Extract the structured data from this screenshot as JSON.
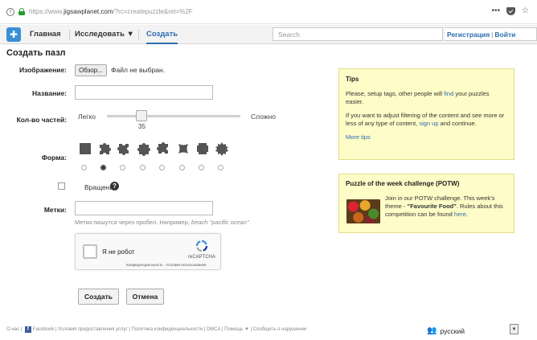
{
  "browser": {
    "url_prefix": "https://www.",
    "url_domain": "jigsawplanet.com",
    "url_rest": "/?rc=createpuzzle&ret=%2F",
    "menu_glyph": "•••",
    "star_glyph": "☆"
  },
  "nav": {
    "logo_glyph": "✚",
    "items": [
      {
        "label": "Главная"
      },
      {
        "label": "Исследовать ▼"
      },
      {
        "label": "Создать"
      }
    ],
    "search_placeholder": "Search",
    "register": "Регистрация",
    "separator": "|",
    "login": "Войти"
  },
  "form": {
    "title": "Создать пазл",
    "image_label": "Изображение:",
    "browse_button": "Обзор...",
    "file_status": "Файл не выбран.",
    "name_label": "Название:",
    "name_value": "",
    "pieces_label": "Кол-во частей:",
    "difficulty_easy": "Легко",
    "difficulty_hard": "Сложно",
    "pieces_value": 35,
    "pieces_value_text": "35",
    "pieces_slider_fraction": 0.2,
    "shape_label": "Форма:",
    "shape_selected_index": 1,
    "rotation_label": "Вращение",
    "rotation_checked": false,
    "help_glyph": "?",
    "tags_label": "Метки:",
    "tags_value": "",
    "tags_hint": "Метки пишутся через пробел. Например, ",
    "tags_hint_example": "beach \"pacific ocean\"",
    "captcha_label": "Я не робот",
    "captcha_brand": "reCAPTCHA",
    "captcha_links": "Конфиденциальность - Условия использования",
    "create_button": "Создать",
    "cancel_button": "Отмена"
  },
  "tips": {
    "title": "Tips",
    "p1_before": "Please, setup tags, other people will ",
    "p1_link": "find",
    "p1_after": " your puzzles easier.",
    "p2_before": "If you want to adjust filtering of the content and see more or less of any type of content, ",
    "p2_link": "sign up",
    "p2_after": " and continue.",
    "more_link": "More tips"
  },
  "potw": {
    "title": "Puzzle of the week challenge (POTW)",
    "text_before": "Join in our POTW challenge. This week's theme - ",
    "theme": "\"Favourite Food\"",
    "text_mid": ". Rules about this competition can be found ",
    "link": "here",
    "text_after": "."
  },
  "footer": {
    "links_before": "О нас | ",
    "fb_glyph": "f",
    "links_after": "Facebook | Условия предоставления услуг | Политика конфиденциальности | DMCA | Помощь ▼ | Сообщить о нарушении",
    "lang_icon": "👥",
    "language": "русский",
    "lang_dropdown": "▼"
  },
  "colors": {
    "accent": "#2b6cb0",
    "tip_bg": "#fefcc7",
    "shape_fill": "#555555"
  }
}
